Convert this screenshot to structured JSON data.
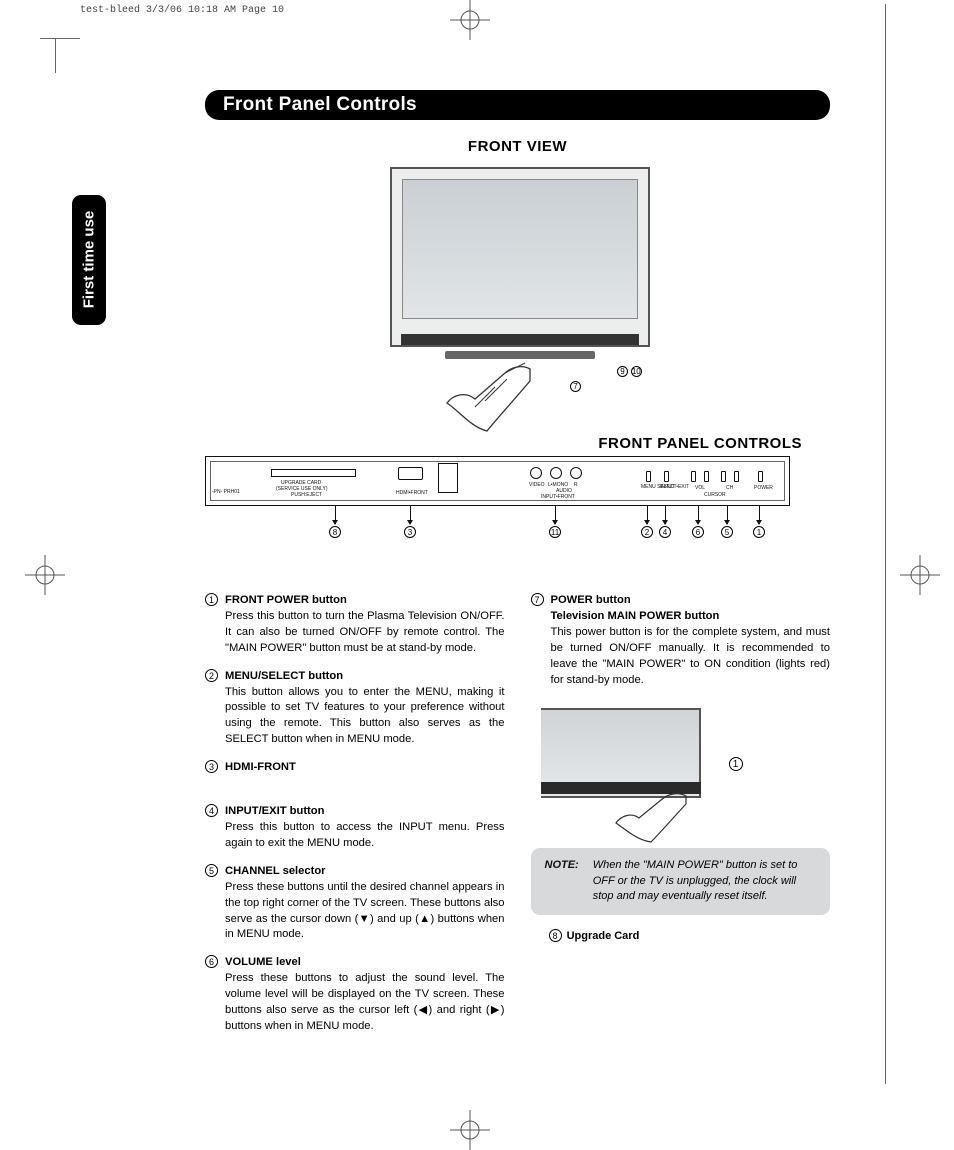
{
  "header_meta": "test-bleed  3/3/06  10:18 AM  Page 10",
  "title": "Front Panel Controls",
  "side_tab": "First time use",
  "front_view_label": "FRONT VIEW",
  "panel_label": "FRONT PANEL CONTROLS",
  "panel_texts": {
    "upgrade": "UPGRADE CARD",
    "service": "(SERVICE USE ONLY)",
    "pusheject": "PUSH:EJECT",
    "hdmi": "HDMI•FRONT",
    "video": "VIDEO",
    "lmono": "L•MONO",
    "r": "R",
    "audio": "AUDIO",
    "inputfront": "INPUT•FRONT",
    "menu": "MENU SELECT",
    "inputexit": "INPUT •EXIT",
    "vol": "VOL",
    "ch": "CH",
    "cursor": "CURSOR",
    "power": "POWER",
    "pn": "-PN- PRH01"
  },
  "refs": {
    "r1": "1",
    "r2": "2",
    "r3": "3",
    "r4": "4",
    "r5": "5",
    "r6": "6",
    "r7": "7",
    "r8": "8",
    "r9": "9",
    "r10": "10",
    "r11": "11"
  },
  "left_col": [
    {
      "num": "1",
      "title": "FRONT POWER button",
      "body": "Press this button to turn the Plasma Television ON/OFF.  It can also be turned ON/OFF by remote control.  The \"MAIN POWER\" button must be at stand-by mode."
    },
    {
      "num": "2",
      "title": "MENU/SELECT button",
      "body": "This button allows you to enter the MENU, making it possible to set TV features to your preference without using the remote.  This button also serves as the SELECT button when in MENU mode."
    },
    {
      "num": "3",
      "title": "HDMI-FRONT",
      "body": ""
    },
    {
      "num": "4",
      "title": "INPUT/EXIT button",
      "body": "Press this button to access the INPUT menu.  Press again to exit the MENU mode."
    },
    {
      "num": "5",
      "title": "CHANNEL selector",
      "body": "Press these buttons until the desired channel appears in the top right corner of the TV screen.  These buttons also serve as the cursor down (▼) and up (▲) buttons when in MENU mode."
    },
    {
      "num": "6",
      "title": "VOLUME level",
      "body": "Press these buttons to adjust the sound level.  The volume level will be displayed on the TV screen.  These buttons also serve as the cursor left (◀) and right (▶) buttons when in MENU mode."
    }
  ],
  "right_col": {
    "num": "7",
    "title": "POWER button",
    "subtitle": "Television MAIN POWER  button",
    "body": "This power button is for the complete system, and must be turned ON/OFF manually.  It is recommended  to leave the \"MAIN POWER\" to ON condition (lights red) for stand-by mode."
  },
  "closeup_ref": "1",
  "note": {
    "label": "NOTE:",
    "body": "When the \"MAIN POWER\" button is set to OFF or the TV is unplugged, the clock will stop and may eventually reset itself."
  },
  "upgrade_card": {
    "num": "8",
    "label": "Upgrade Card"
  }
}
